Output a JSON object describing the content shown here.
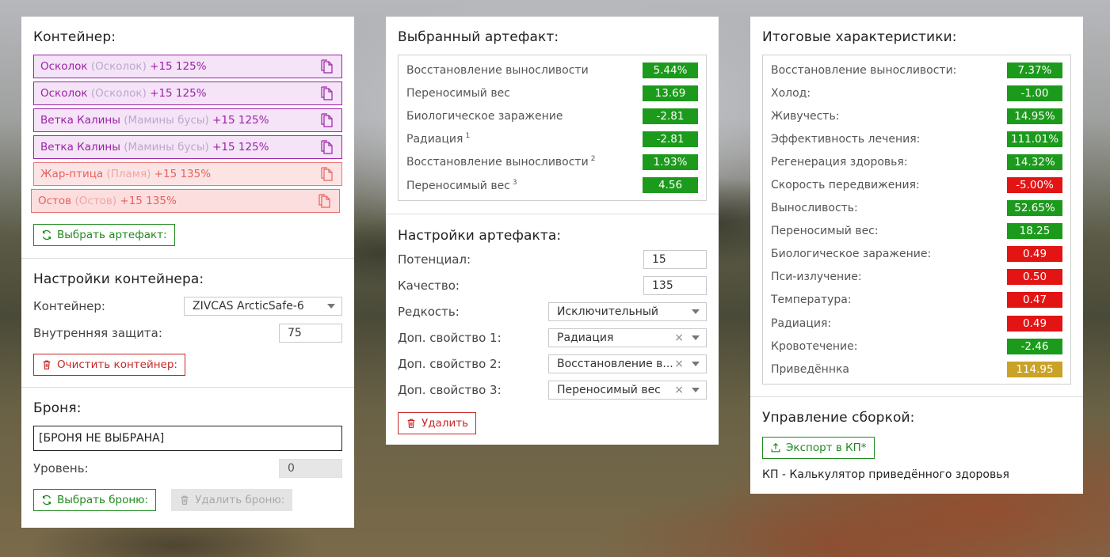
{
  "colors": {
    "green": "#1c9a1c",
    "red": "#e21414",
    "gold": "#c9a227",
    "purple": "#9c23a6",
    "pink": "#e86060"
  },
  "left": {
    "container": {
      "title": "Контейнер:",
      "items": [
        {
          "name": "Осколок",
          "alt": "(Осколок)",
          "stats": "+15 125%",
          "style": "purple"
        },
        {
          "name": "Осколок",
          "alt": "(Осколок)",
          "stats": "+15 125%",
          "style": "purple"
        },
        {
          "name": "Ветка Калины",
          "alt": "(Мамины бусы)",
          "stats": "+15 125%",
          "style": "purple"
        },
        {
          "name": "Ветка Калины",
          "alt": "(Мамины бусы)",
          "stats": "+15 125%",
          "style": "purple"
        },
        {
          "name": "Жар-птица",
          "alt": "(Пламя)",
          "stats": "+15 135%",
          "style": "pink"
        },
        {
          "name": "Остов",
          "alt": "(Остов)",
          "stats": "+15 135%",
          "style": "pink"
        }
      ],
      "select_button": "Выбрать артефакт:"
    },
    "settings": {
      "title": "Настройки контейнера:",
      "container_label": "Контейнер:",
      "container_value": "ZIVCAS ArcticSafe-6",
      "protection_label": "Внутренняя защита:",
      "protection_value": "75",
      "clear_button": "Очистить контейнер:"
    },
    "armor": {
      "title": "Броня:",
      "value": "[БРОНЯ НЕ ВЫБРАНА]",
      "level_label": "Уровень:",
      "level_value": "0",
      "select_button": "Выбрать броню:",
      "delete_button": "Удалить броню:"
    }
  },
  "middle": {
    "selected": {
      "title": "Выбранный артефакт:",
      "stats": [
        {
          "name": "Восстановление выносливости",
          "sup": "",
          "value": "5.44%",
          "color": "green"
        },
        {
          "name": "Переносимый вес",
          "sup": "",
          "value": "13.69",
          "color": "green"
        },
        {
          "name": "Биологическое заражение",
          "sup": "",
          "value": "-2.81",
          "color": "green"
        },
        {
          "name": "Радиация",
          "sup": "1",
          "value": "-2.81",
          "color": "green"
        },
        {
          "name": "Восстановление выносливости",
          "sup": "2",
          "value": "1.93%",
          "color": "green"
        },
        {
          "name": "Переносимый вес",
          "sup": "3",
          "value": "4.56",
          "color": "green"
        }
      ]
    },
    "settings": {
      "title": "Настройки артефакта:",
      "potential_label": "Потенциал:",
      "potential_value": "15",
      "quality_label": "Качество:",
      "quality_value": "135",
      "rarity_label": "Редкость:",
      "rarity_value": "Исключительный",
      "prop1_label": "Доп. свойство 1:",
      "prop1_value": "Радиация",
      "prop2_label": "Доп. свойство 2:",
      "prop2_value": "Восстановление в...",
      "prop3_label": "Доп. свойство 3:",
      "prop3_value": "Переносимый вес",
      "clear_glyph": "×",
      "delete_button": "Удалить"
    }
  },
  "right": {
    "totals": {
      "title": "Итоговые характеристики:",
      "stats": [
        {
          "name": "Восстановление выносливости:",
          "value": "7.37%",
          "color": "green"
        },
        {
          "name": "Холод:",
          "value": "-1.00",
          "color": "green"
        },
        {
          "name": "Живучесть:",
          "value": "14.95%",
          "color": "green"
        },
        {
          "name": "Эффективность лечения:",
          "value": "111.01%",
          "color": "green"
        },
        {
          "name": "Регенерация здоровья:",
          "value": "14.32%",
          "color": "green"
        },
        {
          "name": "Скорость передвижения:",
          "value": "-5.00%",
          "color": "red"
        },
        {
          "name": "Выносливость:",
          "value": "52.65%",
          "color": "green"
        },
        {
          "name": "Переносимый вес:",
          "value": "18.25",
          "color": "green"
        },
        {
          "name": "Биологическое заражение:",
          "value": "0.49",
          "color": "red"
        },
        {
          "name": "Пси-излучение:",
          "value": "0.50",
          "color": "red"
        },
        {
          "name": "Температура:",
          "value": "0.47",
          "color": "red"
        },
        {
          "name": "Радиация:",
          "value": "0.49",
          "color": "red"
        },
        {
          "name": "Кровотечение:",
          "value": "-2.46",
          "color": "green"
        },
        {
          "name": "Приведённка",
          "value": "114.95",
          "color": "gold"
        }
      ]
    },
    "build": {
      "title": "Управление сборкой:",
      "export_button": "Экспорт в КП*",
      "footnote": "КП - Калькулятор приведённого здоровья"
    }
  }
}
